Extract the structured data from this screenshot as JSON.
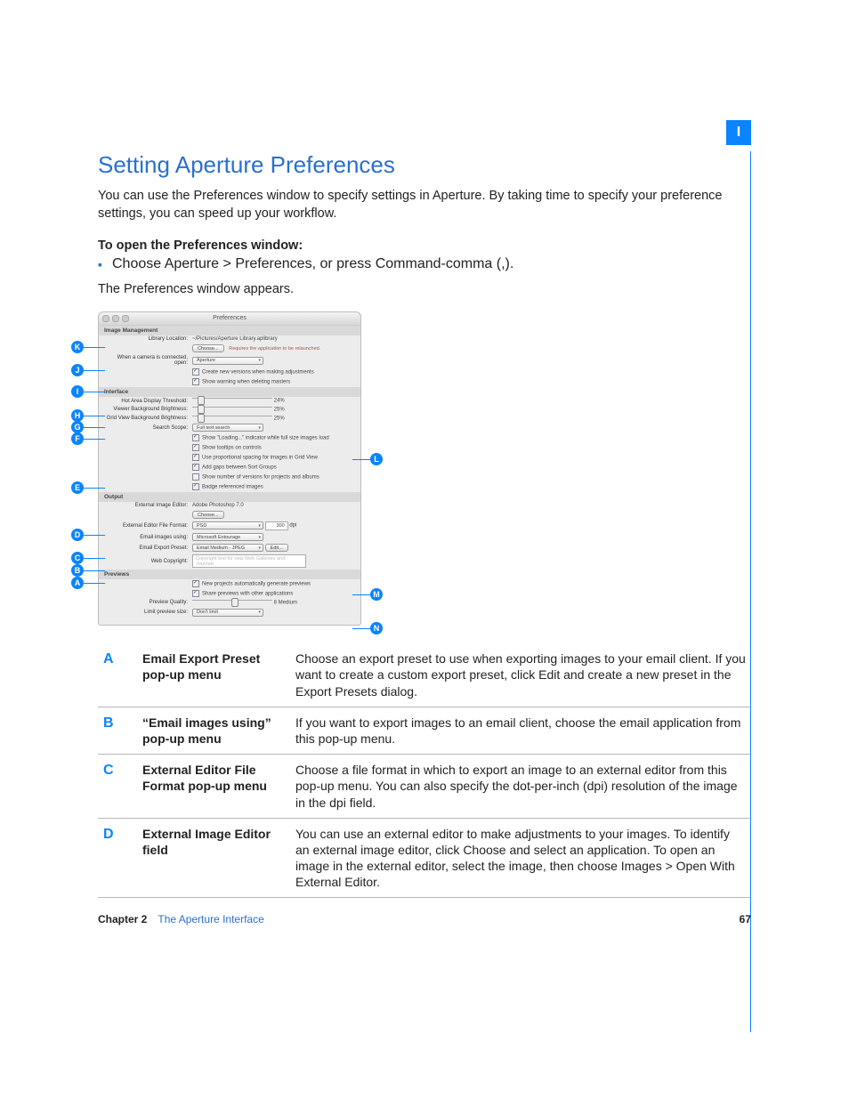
{
  "tab_label": "I",
  "heading": "Setting Aperture Preferences",
  "intro": "You can use the Preferences window to specify settings in Aperture. By taking time to specify your preference settings, you can speed up your workflow.",
  "subhead": "To open the Preferences window:",
  "bullet": "Choose Aperture > Preferences, or press Command-comma (,).",
  "after_bullet": "The Preferences window appears.",
  "prefs": {
    "window_title": "Preferences",
    "sections": {
      "image_mgmt": "Image Management",
      "interface": "Interface",
      "output": "Output",
      "previews": "Previews"
    },
    "labels": {
      "library_location": "Library Location:",
      "library_path": "~/Pictures/Aperture Library.aplibrary",
      "choose_btn": "Choose...",
      "relaunch_hint": "Requires the application to be relaunched.",
      "camera_open": "When a camera is connected, open:",
      "camera_open_val": "Aperture",
      "chk_new_versions": "Create new versions when making adjustments",
      "chk_warn_delete": "Show warning when deleting masters",
      "hot_area": "Hot Area Display Threshold:",
      "hot_area_val": "24%",
      "viewer_bg": "Viewer Background Brightness:",
      "viewer_bg_val": "25%",
      "grid_bg": "Grid View Background Brightness:",
      "grid_bg_val": "25%",
      "search_scope": "Search Scope:",
      "search_scope_val": "Full text search",
      "chk_loading": "Show \"Loading...\" indicator while full size images load",
      "chk_tooltips": "Show tooltips on controls",
      "chk_proportional": "Use proportional spacing for images in Grid View",
      "chk_gaps": "Add gaps between Sort Groups",
      "chk_counts": "Show number of versions for projects and albums",
      "chk_badge": "Badge referenced images",
      "ext_editor": "External Image Editor:",
      "ext_editor_val": "Adobe Photoshop 7.0",
      "ext_format": "External Editor File Format:",
      "ext_format_val": "PSD",
      "dpi": "300",
      "dpi_unit": "dpi",
      "email_using": "Email images using:",
      "email_using_val": "Microsoft Entourage",
      "email_preset": "Email Export Preset:",
      "email_preset_val": "Email Medium - JPEG",
      "edit_btn": "Edit...",
      "web_copy": "Web Copyright:",
      "web_copy_ph": "Copyright text for new Web Galleries and Journals",
      "chk_auto_prev": "New projects automatically generate previews",
      "chk_share_prev": "Share previews with other applications",
      "prev_quality": "Preview Quality:",
      "prev_quality_val": "8 Medium",
      "limit_size": "Limit preview size:",
      "limit_size_val": "Don't limit"
    }
  },
  "callouts_left": [
    "K",
    "J",
    "I",
    "H",
    "G",
    "F",
    "E",
    "D",
    "C",
    "B",
    "A"
  ],
  "callouts_right": [
    "L",
    "M",
    "N"
  ],
  "legend": [
    {
      "l": "A",
      "term": "Email Export Preset pop-up menu",
      "desc": "Choose an export preset to use when exporting images to your email client. If you want to create a custom export preset, click Edit and create a new preset in the Export Presets dialog."
    },
    {
      "l": "B",
      "term": "“Email images using” pop-up menu",
      "desc": "If you want to export images to an email client, choose the email application from this pop-up menu."
    },
    {
      "l": "C",
      "term": "External Editor File Format pop-up menu",
      "desc": "Choose a file format in which to export an image to an external editor from this pop-up menu. You can also specify the dot-per-inch (dpi) resolution of the image in the dpi field."
    },
    {
      "l": "D",
      "term": "External Image Editor field",
      "desc": "You can use an external editor to make adjustments to your images. To identify an external image editor, click Choose and select an application. To open an image in the external editor, select the image, then choose Images > Open With External Editor."
    }
  ],
  "footer": {
    "chapter": "Chapter 2",
    "title": "The Aperture Interface",
    "page": "67"
  }
}
